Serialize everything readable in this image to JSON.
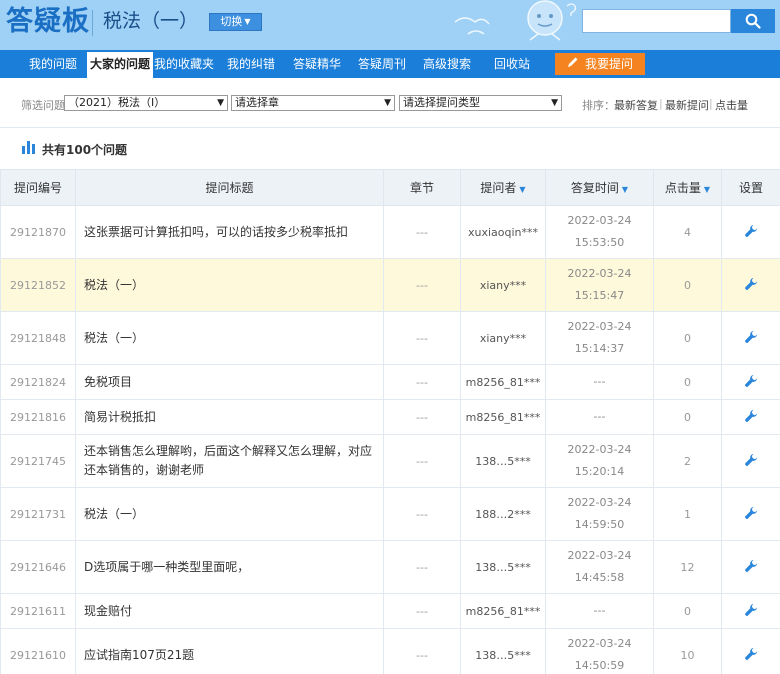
{
  "header": {
    "logo": "答疑板",
    "subject": "税法（一）",
    "switch_label": "切换",
    "search_placeholder": ""
  },
  "nav": {
    "items": [
      {
        "label": "我的问题"
      },
      {
        "label": "大家的问题"
      },
      {
        "label": "我的收藏夹"
      },
      {
        "label": "我的纠错"
      },
      {
        "label": "答疑精华"
      },
      {
        "label": "答疑周刊"
      },
      {
        "label": "高级搜索"
      },
      {
        "label": "回收站"
      }
    ],
    "active_index": 1,
    "ask_label": "我要提问"
  },
  "filter": {
    "label": "筛选问题",
    "course_select": "（2021）税法（Ⅰ）",
    "chapter_select": "请选择章",
    "type_select": "请选择提问类型",
    "sort_label": "排序：",
    "sort_options": [
      "最新答复",
      "最新提问",
      "点击量"
    ]
  },
  "count_text": "共有100个问题",
  "table": {
    "headers": [
      "提问编号",
      "提问标题",
      "章节",
      "提问者",
      "答复时间",
      "点击量",
      "设置"
    ],
    "rows": [
      {
        "id": "29121870",
        "title": "这张票据可计算抵扣吗，可以的话按多少税率抵扣",
        "chapter": "---",
        "asker": "xuxiaoqin***",
        "date": "2022-03-24",
        "time": "15:53:50",
        "clicks": "4"
      },
      {
        "id": "29121852",
        "title": "税法（一）",
        "chapter": "---",
        "asker": "xiany***",
        "date": "2022-03-24",
        "time": "15:15:47",
        "clicks": "0"
      },
      {
        "id": "29121848",
        "title": "税法（一）",
        "chapter": "---",
        "asker": "xiany***",
        "date": "2022-03-24",
        "time": "15:14:37",
        "clicks": "0"
      },
      {
        "id": "29121824",
        "title": "免税项目",
        "chapter": "---",
        "asker": "m8256_81***",
        "date": "---",
        "time": "",
        "clicks": "0"
      },
      {
        "id": "29121816",
        "title": "简易计税抵扣",
        "chapter": "---",
        "asker": "m8256_81***",
        "date": "---",
        "time": "",
        "clicks": "0"
      },
      {
        "id": "29121745",
        "title": "还本销售怎么理解哟，后面这个解释又怎么理解，对应还本销售的，谢谢老师",
        "chapter": "---",
        "asker": "138…5***",
        "date": "2022-03-24",
        "time": "15:20:14",
        "clicks": "2"
      },
      {
        "id": "29121731",
        "title": "税法（一）",
        "chapter": "---",
        "asker": "188…2***",
        "date": "2022-03-24",
        "time": "14:59:50",
        "clicks": "1"
      },
      {
        "id": "29121646",
        "title": "D选项属于哪一种类型里面呢，",
        "chapter": "---",
        "asker": "138…5***",
        "date": "2022-03-24",
        "time": "14:45:58",
        "clicks": "12"
      },
      {
        "id": "29121611",
        "title": "现金赔付",
        "chapter": "---",
        "asker": "m8256_81***",
        "date": "---",
        "time": "",
        "clicks": "0"
      },
      {
        "id": "29121610",
        "title": "应试指南107页21题",
        "chapter": "---",
        "asker": "138…5***",
        "date": "2022-03-24",
        "time": "14:50:59",
        "clicks": "10"
      }
    ],
    "highlight_row": 1
  },
  "colors": {
    "header_bg": "#9fd0f5",
    "nav_bg": "#1b7fd9",
    "accent_orange": "#f5831f",
    "highlight_row": "#fff9dc"
  }
}
